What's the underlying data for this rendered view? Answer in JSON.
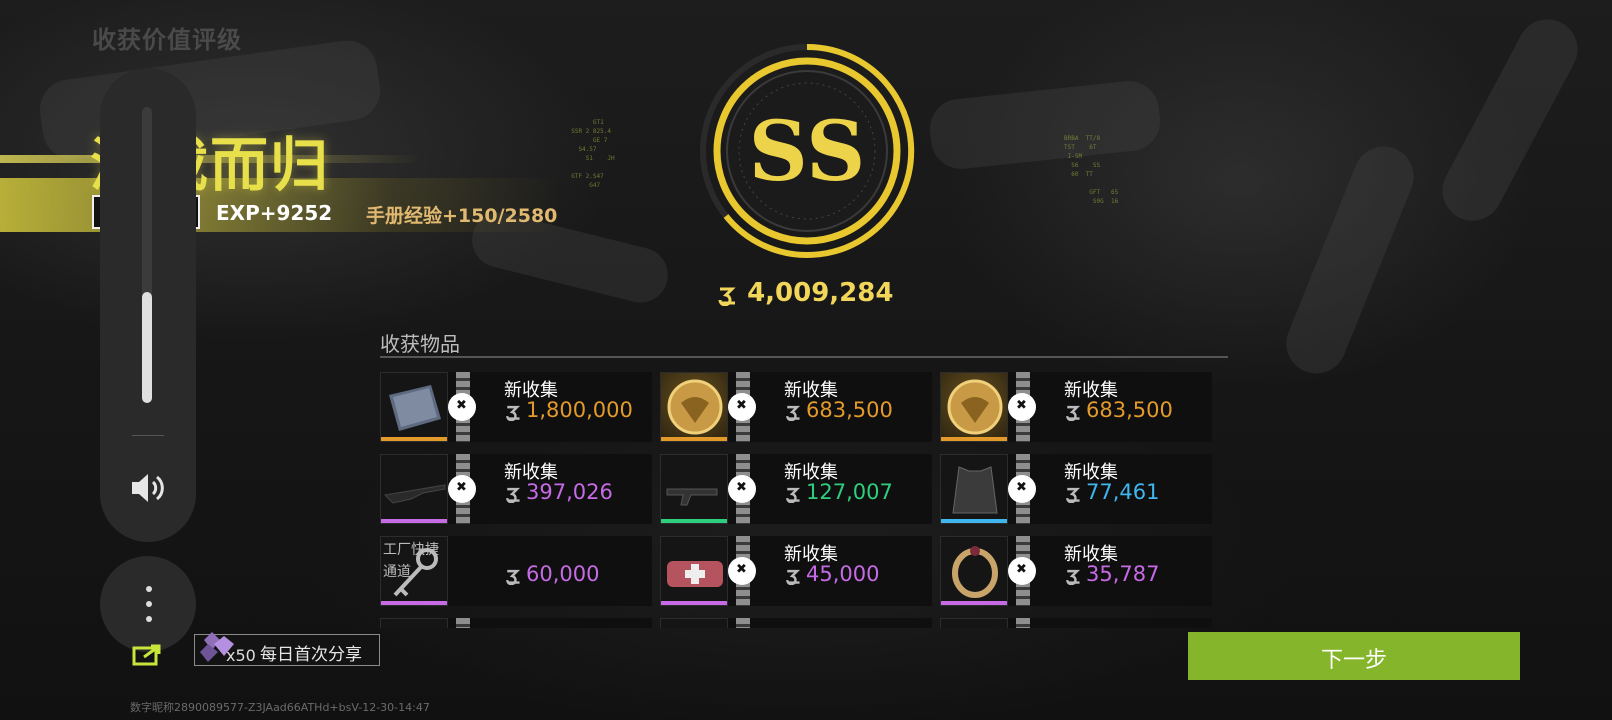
{
  "header": {
    "title": "收获价值评级"
  },
  "result": {
    "title": "满载而归",
    "exp": "EXP+9252",
    "handbook": "手册经验+150/2580"
  },
  "rating": {
    "grade": "SS",
    "total_value": "4,009,284"
  },
  "loot": {
    "section_title": "收获物品",
    "items": [
      {
        "label": "新收集",
        "value": "1,800,000",
        "color": "#e39a2a",
        "rarity": "#e39a2a",
        "icon": "notebook-icon"
      },
      {
        "label": "新收集",
        "value": "683,500",
        "color": "#e39a2a",
        "rarity": "#e39a2a",
        "icon": "gold-coin-icon"
      },
      {
        "label": "新收集",
        "value": "683,500",
        "color": "#e39a2a",
        "rarity": "#e39a2a",
        "icon": "gold-coin-icon"
      },
      {
        "label": "新收集",
        "value": "397,026",
        "color": "#c76ae6",
        "rarity": "#c76ae6",
        "icon": "rifle-icon"
      },
      {
        "label": "新收集",
        "value": "127,007",
        "color": "#2fce7e",
        "rarity": "#2fce7e",
        "icon": "machine-gun-icon"
      },
      {
        "label": "新收集",
        "value": "77,461",
        "color": "#3fb6ee",
        "rarity": "#3fb6ee",
        "icon": "vest-icon"
      },
      {
        "label": "工厂快捷通道",
        "value": "60,000",
        "color": "#c76ae6",
        "rarity": "#c76ae6",
        "icon": "key-icon"
      },
      {
        "label": "新收集",
        "value": "45,000",
        "color": "#c76ae6",
        "rarity": "#c76ae6",
        "icon": "medkit-icon"
      },
      {
        "label": "新收集",
        "value": "35,787",
        "color": "#c76ae6",
        "rarity": "#c76ae6",
        "icon": "ring-icon"
      }
    ]
  },
  "share": {
    "count": "x50",
    "text": "每日首次分享"
  },
  "next_button": "下一步",
  "footer": "数字昵称2890089577-Z3JAad66ATHd+bsV-12-30-14:47"
}
